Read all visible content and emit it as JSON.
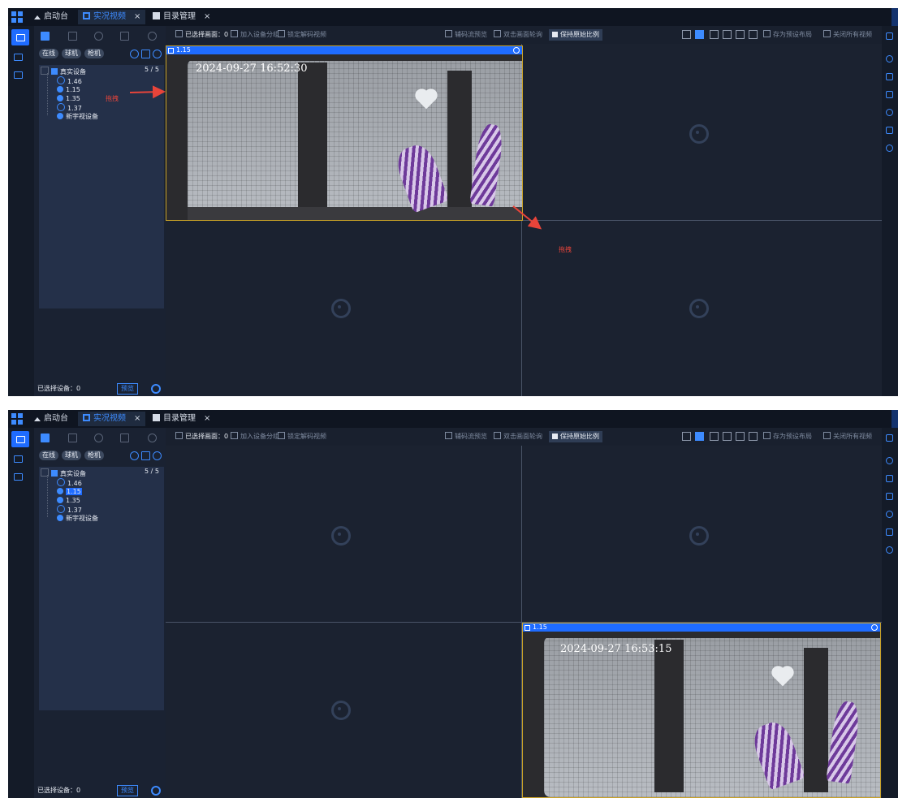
{
  "tabs": [
    {
      "label": "启动台",
      "icon": "home-icon"
    },
    {
      "label": "实况视频",
      "icon": "video-icon",
      "close": "×"
    },
    {
      "label": "目录管理",
      "icon": "catalog-icon",
      "close": "×"
    }
  ],
  "sidebar": {
    "filters": [
      "在线",
      "球机",
      "枪机"
    ],
    "tree_root": "真实设备",
    "count": "5 / 5",
    "devices": [
      "1.46",
      "1.15",
      "1.35",
      "1.37"
    ],
    "extra_device": "新宇视设备",
    "footer": "已选择设备：0",
    "preview_button": "预览"
  },
  "toolbar": {
    "selected": "已选择画面：0",
    "add_group": "加入设备分组",
    "lock_decode": "锁定解码视频",
    "decode_preview": "辅码流预览",
    "dbl_click": "双击画面轮询",
    "keep_ratio": "保持原始比例",
    "save_layout": "存为预设布局",
    "close_all": "关闭所有视频"
  },
  "panels": [
    {
      "video_label": "1.15",
      "timestamp": "2024-09-27 16:52:30",
      "drag_labels": [
        "拖拽",
        "拖拽"
      ]
    },
    {
      "video_label": "1.15",
      "timestamp": "2024-09-27 16:53:15",
      "selected_device": "1.15"
    }
  ],
  "colors": {
    "accent": "#1f6cff",
    "selection_border": "#c9a227",
    "annotation": "#e8443a"
  }
}
